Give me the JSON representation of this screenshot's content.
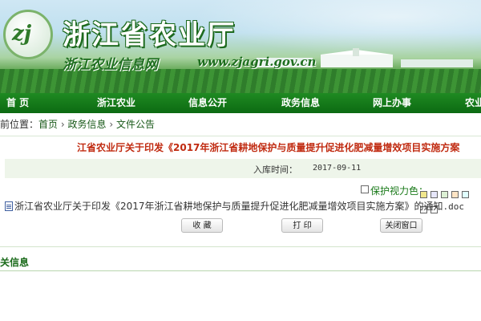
{
  "header": {
    "title": "浙江省农业厅",
    "subtitle": "浙江农业信息网",
    "url": "www.zjagri.gov.cn",
    "logo_text": "zj"
  },
  "nav": {
    "items": [
      "首  页",
      "浙江农业",
      "信息公开",
      "政务信息",
      "网上办事",
      "农业"
    ]
  },
  "breadcrumb": {
    "prefix": "前位置：",
    "items": [
      "首页",
      "政务信息",
      "文件公告"
    ],
    "separator": "›"
  },
  "article": {
    "title": "江省农业厅关于印发《2017年浙江省耕地保护与质量提升促进化肥减量增效项目实施方案",
    "date_label": "入库时间：",
    "date_value": "2017-09-11"
  },
  "eye_care": {
    "label": "保护视力色：",
    "colors": [
      "#f0e68c",
      "#e6e6fa",
      "#dcf0d4",
      "#ffe4c4",
      "#e0ffff",
      "#f5f5f5",
      "#ffffff"
    ]
  },
  "attachment": {
    "name": "浙江省农业厅关于印发《2017年浙江省耕地保护与质量提升促进化肥减量增效项目实施方案》的通知",
    "ext": ".doc"
  },
  "buttons": {
    "favorite": "收  藏",
    "print": "打  印",
    "close": "关闭窗口"
  },
  "related": {
    "title": "关信息"
  },
  "colors": {
    "nav_green": "#0c6a12",
    "title_red": "#c02a10",
    "link_green": "#1a5a1a"
  }
}
